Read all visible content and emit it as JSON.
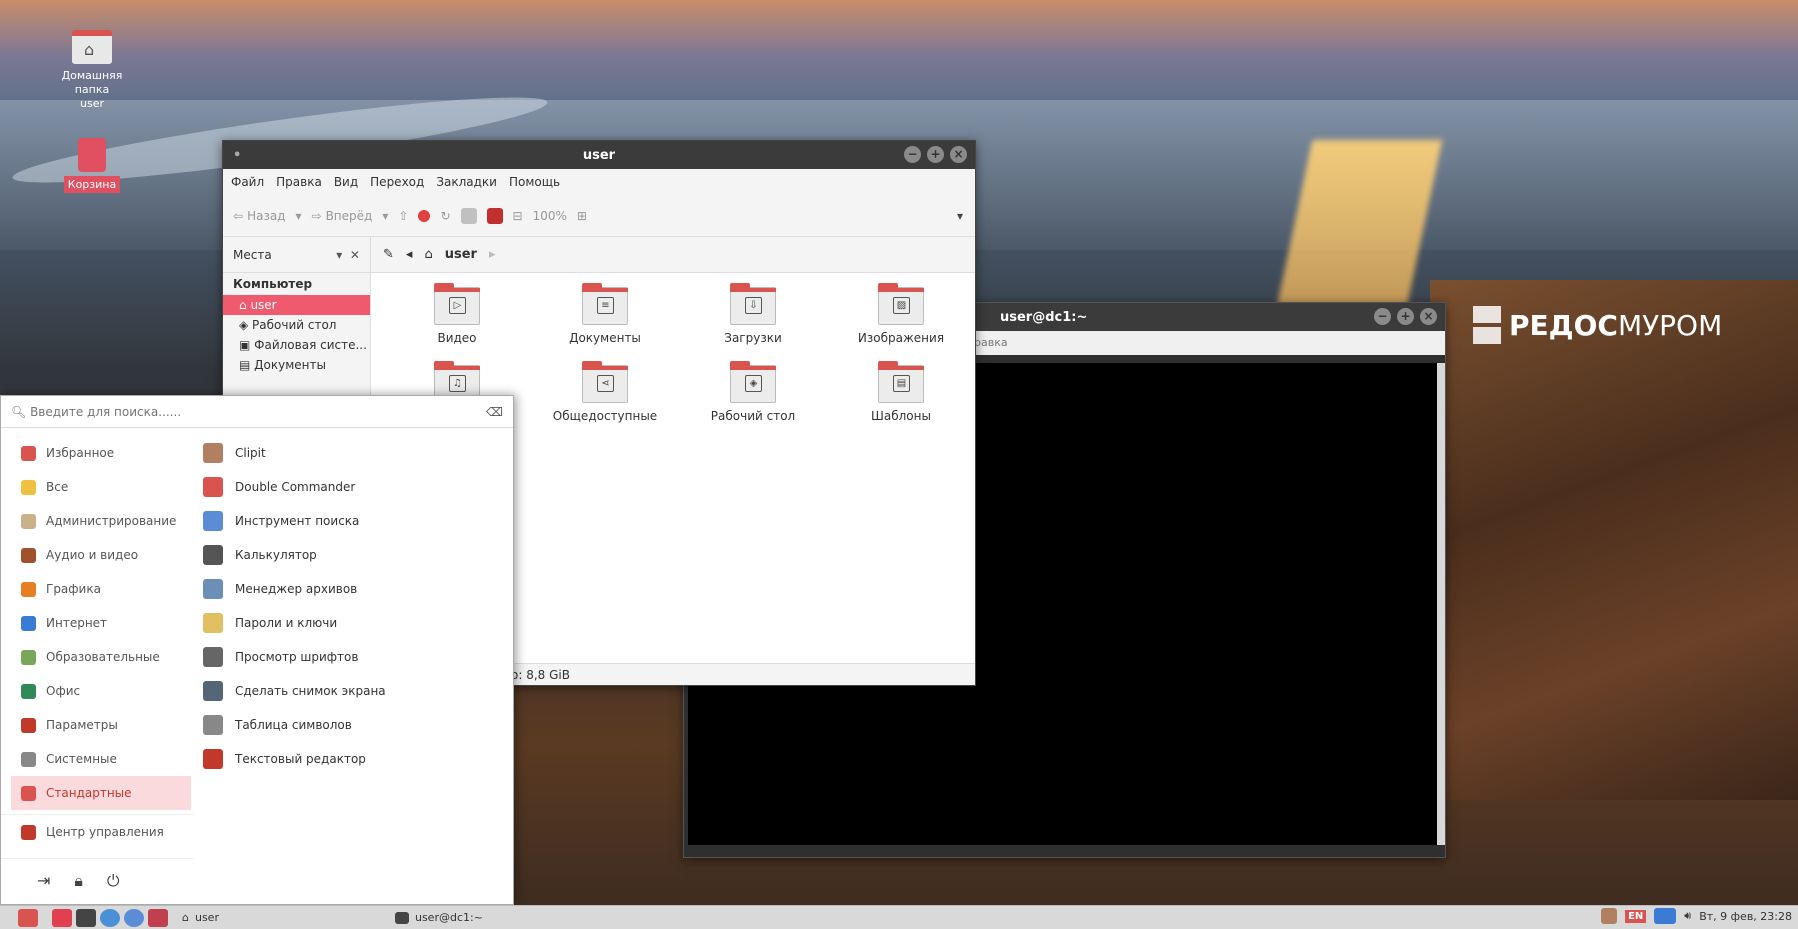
{
  "desktop": {
    "icons": [
      {
        "label_lines": [
          "Домашняя папка",
          "user"
        ],
        "icon": "home-folder-icon"
      },
      {
        "label_lines": [
          "Корзина"
        ],
        "icon": "trash-icon"
      }
    ],
    "brand": {
      "part1": "РЕД",
      "part2": "ОС",
      "part3": "МУРОМ"
    }
  },
  "file_manager": {
    "title": "user",
    "menu": [
      "Файл",
      "Правка",
      "Вид",
      "Переход",
      "Закладки",
      "Помощь"
    ],
    "toolbar": {
      "back": "Назад",
      "forward": "Вперёд",
      "zoom": "100%"
    },
    "places_label": "Места",
    "path_current": "user",
    "sidebar": {
      "header": "Компьютер",
      "items": [
        "user",
        "Рабочий стол",
        "Файловая систе...",
        "Документы"
      ]
    },
    "folders": [
      {
        "name": "Видео",
        "glyph": "▷"
      },
      {
        "name": "Документы",
        "glyph": "≡"
      },
      {
        "name": "Загрузки",
        "glyph": "⇩"
      },
      {
        "name": "Изображения",
        "glyph": "▨"
      },
      {
        "name": "",
        "glyph": "♫"
      },
      {
        "name": "Общедоступные",
        "glyph": "⋖"
      },
      {
        "name": "Рабочий стол",
        "glyph": "◈"
      },
      {
        "name": "Шаблоны",
        "glyph": "▤"
      }
    ],
    "status": "о: 8,8 GiB"
  },
  "terminal": {
    "title": "user@dc1:~",
    "menu_fragment": "равка"
  },
  "app_menu": {
    "search_placeholder": "Введите для поиска......",
    "categories": [
      "Избранное",
      "Все",
      "Администрирование",
      "Аудио и видео",
      "Графика",
      "Интернет",
      "Образовательные",
      "Офис",
      "Параметры",
      "Системные",
      "Стандартные"
    ],
    "category_colors": [
      "#d9534f",
      "#f0c040",
      "#c9b28a",
      "#a0522d",
      "#e67e22",
      "#3a7bd5",
      "#7aa65a",
      "#2e8b57",
      "#c0392b",
      "#888888",
      "#d9534f"
    ],
    "active_category": "Стандартные",
    "apps": [
      "Clipit",
      "Double Commander",
      "Инструмент поиска",
      "Калькулятор",
      "Менеджер архивов",
      "Пароли и ключи",
      "Просмотр шрифтов",
      "Сделать снимок экрана",
      "Таблица символов",
      "Текстовый редактор"
    ],
    "app_colors": [
      "#b08060",
      "#d9534f",
      "#5a8dd6",
      "#555555",
      "#6b8fb5",
      "#e0c060",
      "#666666",
      "#556677",
      "#888888",
      "#c0392b"
    ],
    "control_center": "Центр управления"
  },
  "taskbar": {
    "tasks": [
      "user",
      "user@dc1:~"
    ],
    "lang": "EN",
    "clock": "Вт, 9 фев, 23:28"
  }
}
